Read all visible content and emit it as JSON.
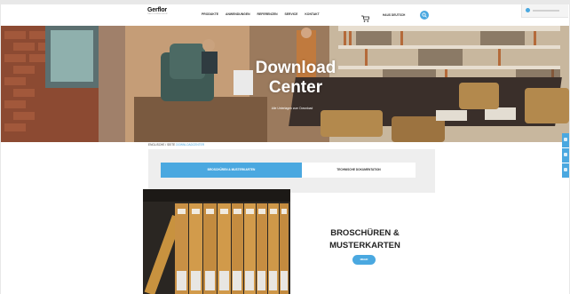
{
  "header": {
    "logo_text": "Gerflor",
    "logo_sub": "THE FLOORING GROUP",
    "nav": [
      "PRODUKTE",
      "ANWENDUNGEN",
      "REFERENZEN",
      "SERVICE",
      "KONTAKT"
    ],
    "language": "HAUS DEUTSCH",
    "cart_icon": "cart-icon",
    "search_icon": "search-icon"
  },
  "hero": {
    "title_line1": "Download",
    "title_line2": "Center",
    "subtitle": "Alle Unterlagen zum Download"
  },
  "breadcrumb": {
    "parent": "ENGLISCHE / SEITE",
    "current": "DOWNLOADCENTER"
  },
  "tabs": {
    "active": "Broschüren & Musterkarten",
    "inactive": "Technische Dokumentation"
  },
  "content": {
    "title_line1": "BROSCHÜREN &",
    "title_line2": "MUSTERKARTEN",
    "button": "MEHR"
  },
  "colors": {
    "accent": "#4aa8e0"
  }
}
